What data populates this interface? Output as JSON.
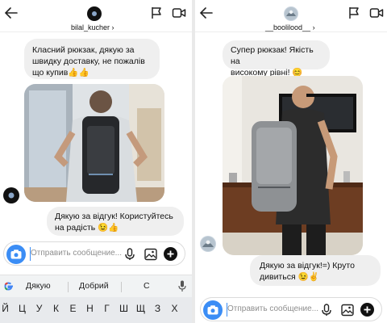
{
  "left_chat": {
    "username": "bilal_kucher",
    "chevron": "›",
    "message_in": [
      "Класний рюкзак, дякую за",
      "швидку доставку, не пожалів",
      "що купив👍👍"
    ],
    "message_out": [
      "Дякую за відгук! Користуйтесь",
      "на радість 😉👍"
    ],
    "composer_placeholder": "Отправить сообщение...",
    "keyboard": {
      "suggestions": [
        "Дякую",
        "Добрий",
        "С"
      ],
      "keys": [
        "Й",
        "Ц",
        "У",
        "К",
        "Е",
        "Н",
        "Г",
        "Ш",
        "Щ",
        "З",
        "Х"
      ]
    }
  },
  "right_chat": {
    "username": "__boolilood__",
    "chevron": "›",
    "message_in": [
      "Супер рюкзак! Якість на",
      "високому рівні! 😊"
    ],
    "message_out": [
      "Дякую за відгук!=) Круто",
      "дивиться   😉✌"
    ],
    "composer_placeholder": "Отправить сообщение..."
  },
  "icons": {
    "back": "back-arrow-icon",
    "flag": "flag-icon",
    "video": "video-camera-icon",
    "camera": "camera-icon",
    "mic": "microphone-icon",
    "gallery": "gallery-icon",
    "plus": "plus-icon",
    "google": "google-g-icon"
  },
  "colors": {
    "accent": "#3b8df5",
    "bubble": "#efefef",
    "keyboard": "#e8eaed"
  }
}
